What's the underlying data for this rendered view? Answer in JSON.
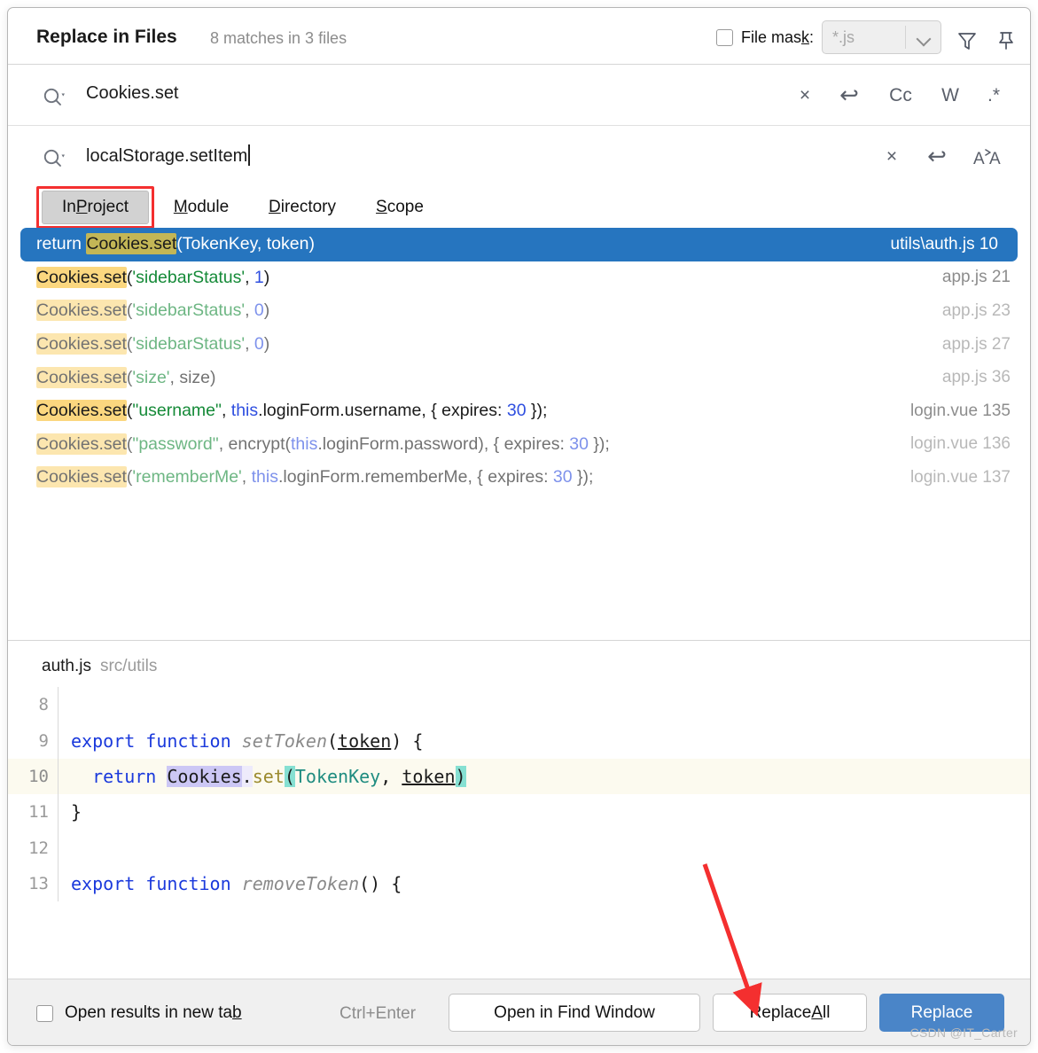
{
  "header": {
    "title": "Replace in Files",
    "matches": "8 matches in 3 files",
    "file_mask_label_a": "File mas",
    "file_mask_label_k": "k",
    "file_mask_label_b": ":",
    "file_mask_value": "*.js",
    "filter_icon": "filter-icon",
    "pin_icon": "pin-icon"
  },
  "search": {
    "find_value": "Cookies.set",
    "replace_value": "localStorage.setItem",
    "find_actions": [
      "×",
      "↩",
      "Cc",
      "W",
      ".*"
    ],
    "replace_actions": [
      "×",
      "↩",
      "Aᴀ"
    ],
    "find_clear": "×",
    "find_history": "↩",
    "match_case": "Cc",
    "words": "W",
    "regex": ".*",
    "replace_clear": "×",
    "replace_history": "↩",
    "preserve_case": "Aᴀ"
  },
  "scopes": [
    {
      "pre": "In ",
      "mn": "P",
      "post": "roject",
      "selected": true
    },
    {
      "pre": "",
      "mn": "M",
      "post": "odule",
      "selected": false
    },
    {
      "pre": "",
      "mn": "D",
      "post": "irectory",
      "selected": false
    },
    {
      "pre": "",
      "mn": "S",
      "post": "cope",
      "selected": false
    }
  ],
  "results": [
    {
      "selected": true,
      "dim": false,
      "parts": [
        {
          "t": "return ",
          "c": "plain"
        },
        {
          "t": "Cookies.set",
          "c": "hl"
        },
        {
          "t": "(TokenKey, token)",
          "c": "plain"
        }
      ],
      "location": "utils\\auth.js 10"
    },
    {
      "selected": false,
      "dim": false,
      "parts": [
        {
          "t": "Cookies.set",
          "c": "hl"
        },
        {
          "t": "(",
          "c": "plain"
        },
        {
          "t": "'sidebarStatus'",
          "c": "str"
        },
        {
          "t": ", ",
          "c": "plain"
        },
        {
          "t": "1",
          "c": "num"
        },
        {
          "t": ")",
          "c": "plain"
        }
      ],
      "location": "app.js 21"
    },
    {
      "selected": false,
      "dim": true,
      "parts": [
        {
          "t": "Cookies.set",
          "c": "hl"
        },
        {
          "t": "(",
          "c": "plain"
        },
        {
          "t": "'sidebarStatus'",
          "c": "str"
        },
        {
          "t": ", ",
          "c": "plain"
        },
        {
          "t": "0",
          "c": "num"
        },
        {
          "t": ")",
          "c": "plain"
        }
      ],
      "location": "app.js 23"
    },
    {
      "selected": false,
      "dim": true,
      "parts": [
        {
          "t": "Cookies.set",
          "c": "hl"
        },
        {
          "t": "(",
          "c": "plain"
        },
        {
          "t": "'sidebarStatus'",
          "c": "str"
        },
        {
          "t": ", ",
          "c": "plain"
        },
        {
          "t": "0",
          "c": "num"
        },
        {
          "t": ")",
          "c": "plain"
        }
      ],
      "location": "app.js 27"
    },
    {
      "selected": false,
      "dim": true,
      "parts": [
        {
          "t": "Cookies.set",
          "c": "hl"
        },
        {
          "t": "(",
          "c": "plain"
        },
        {
          "t": "'size'",
          "c": "str"
        },
        {
          "t": ", size)",
          "c": "plain"
        }
      ],
      "location": "app.js 36"
    },
    {
      "selected": false,
      "dim": false,
      "parts": [
        {
          "t": "Cookies.set",
          "c": "hl"
        },
        {
          "t": "(",
          "c": "plain"
        },
        {
          "t": "\"username\"",
          "c": "str"
        },
        {
          "t": ", ",
          "c": "plain"
        },
        {
          "t": "this",
          "c": "kw"
        },
        {
          "t": ".loginForm.username, { expires: ",
          "c": "plain"
        },
        {
          "t": "30",
          "c": "num"
        },
        {
          "t": " });",
          "c": "plain"
        }
      ],
      "location": "login.vue 135"
    },
    {
      "selected": false,
      "dim": true,
      "parts": [
        {
          "t": "Cookies.set",
          "c": "hl"
        },
        {
          "t": "(",
          "c": "plain"
        },
        {
          "t": "\"password\"",
          "c": "str"
        },
        {
          "t": ", encrypt(",
          "c": "plain"
        },
        {
          "t": "this",
          "c": "kw"
        },
        {
          "t": ".loginForm.password), { expires: ",
          "c": "plain"
        },
        {
          "t": "30",
          "c": "num"
        },
        {
          "t": " });",
          "c": "plain"
        }
      ],
      "location": "login.vue 136"
    },
    {
      "selected": false,
      "dim": true,
      "parts": [
        {
          "t": "Cookies.set",
          "c": "hl"
        },
        {
          "t": "(",
          "c": "plain"
        },
        {
          "t": "'rememberMe'",
          "c": "str"
        },
        {
          "t": ", ",
          "c": "plain"
        },
        {
          "t": "this",
          "c": "kw"
        },
        {
          "t": ".loginForm.rememberMe, { expires: ",
          "c": "plain"
        },
        {
          "t": "30",
          "c": "num"
        },
        {
          "t": " });",
          "c": "plain"
        }
      ],
      "location": "login.vue 137"
    }
  ],
  "preview": {
    "file_name": "auth.js",
    "file_path": "src/utils",
    "lines": [
      {
        "num": "8",
        "current": false,
        "parts": []
      },
      {
        "num": "9",
        "current": false,
        "parts": [
          {
            "t": "export function ",
            "c": "e-kw"
          },
          {
            "t": "setToken",
            "c": "e-fn"
          },
          {
            "t": "(",
            "c": "e-plain"
          },
          {
            "t": "token",
            "c": "e-par"
          },
          {
            "t": ") {",
            "c": "e-plain"
          }
        ]
      },
      {
        "num": "10",
        "current": true,
        "parts": [
          {
            "t": "  return ",
            "c": "e-kw"
          },
          {
            "t": "Cookies",
            "c": "e-lav"
          },
          {
            "t": ".",
            "c": "e-lav2"
          },
          {
            "t": "set",
            "c": "e-dot"
          },
          {
            "t": "(",
            "c": "e-teal"
          },
          {
            "t": "TokenKey",
            "c": "e-tealtxt"
          },
          {
            "t": ", ",
            "c": "e-plain"
          },
          {
            "t": "token",
            "c": "e-par"
          },
          {
            "t": ")",
            "c": "e-teal"
          }
        ]
      },
      {
        "num": "11",
        "current": false,
        "parts": [
          {
            "t": "}",
            "c": "e-plain"
          }
        ]
      },
      {
        "num": "12",
        "current": false,
        "parts": []
      },
      {
        "num": "13",
        "current": false,
        "parts": [
          {
            "t": "export function ",
            "c": "e-kw"
          },
          {
            "t": "removeToken",
            "c": "e-fn"
          },
          {
            "t": "() {",
            "c": "e-plain"
          }
        ]
      }
    ]
  },
  "bottom": {
    "open_new_tab_a": "Open results in new ta",
    "open_new_tab_mn": "b",
    "shortcut": "Ctrl+Enter",
    "open_find_window": "Open in Find Window",
    "replace_all_a": "Replace ",
    "replace_all_mn": "A",
    "replace_all_b": "ll",
    "replace": "Replace",
    "watermark": "CSDN @IT_Carter"
  },
  "colors": {
    "selection_blue": "#2675bf",
    "match_highlight": "#fbd77f",
    "primary_button": "#4a85c8",
    "annotation_red": "#f42f2f",
    "string_green": "#158a38",
    "number_blue": "#2f4fe0"
  }
}
